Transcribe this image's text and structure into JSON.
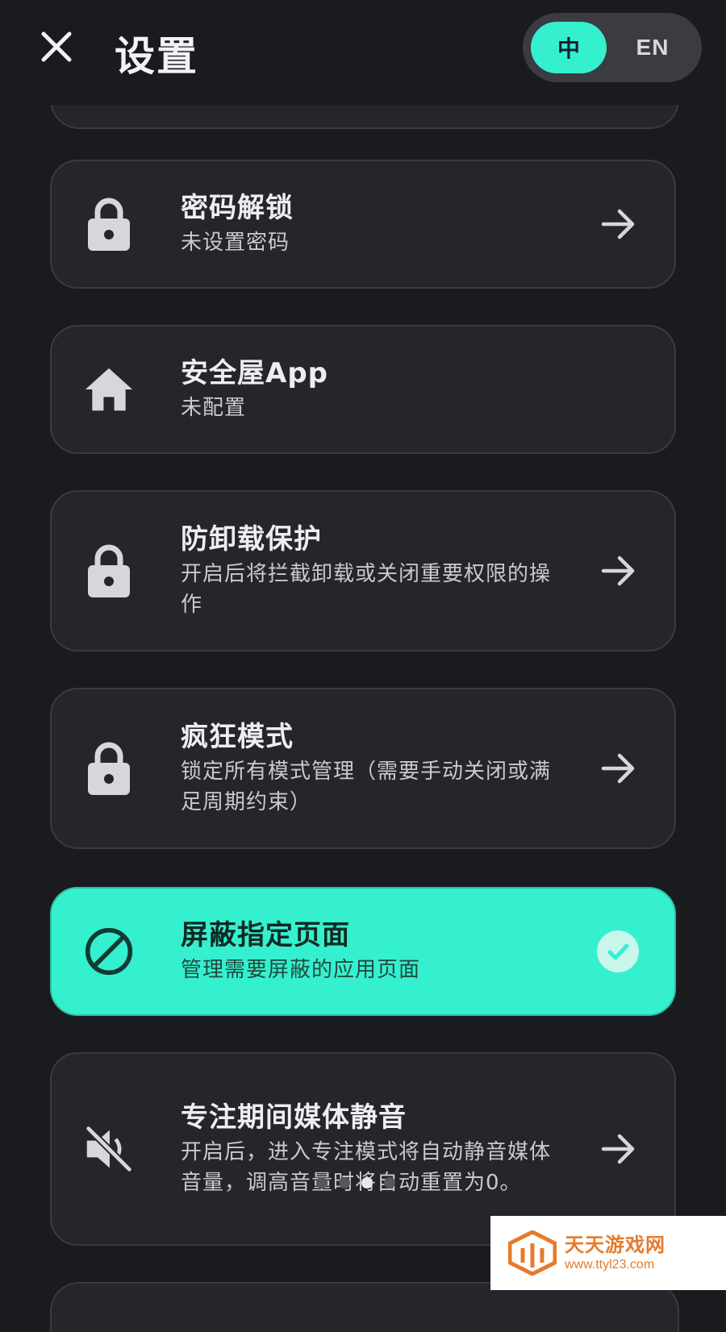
{
  "header": {
    "title": "设置",
    "close_icon": "close-icon",
    "lang": {
      "zh": "中",
      "en": "EN",
      "selected": "zh"
    }
  },
  "colors": {
    "accent": "#35f0cf",
    "background": "#1a1b1f",
    "card": "#25262b"
  },
  "items": [
    {
      "title": "密码解锁",
      "subtitle": "未设置密码",
      "icon": "lock-icon",
      "trailing": "arrow-right-icon"
    },
    {
      "title": "安全屋App",
      "subtitle": "未配置",
      "icon": "home-icon",
      "trailing": "none"
    },
    {
      "title": "防卸载保护",
      "subtitle": "开启后将拦截卸载或关闭重要权限的操作",
      "icon": "lock-icon",
      "trailing": "arrow-right-icon"
    },
    {
      "title": "疯狂模式",
      "subtitle": "锁定所有模式管理（需要手动关闭或满足周期约束）",
      "icon": "lock-icon",
      "trailing": "arrow-right-icon"
    },
    {
      "title": "屏蔽指定页面",
      "subtitle": "管理需要屏蔽的应用页面",
      "icon": "block-icon",
      "trailing": "check-icon",
      "active": true
    },
    {
      "title": "专注期间媒体静音",
      "subtitle": "开启后，进入专注模式将自动静音媒体音量，调高音量时将自动重置为0。",
      "icon": "mute-icon",
      "trailing": "arrow-right-icon"
    }
  ],
  "pager": {
    "count": 4,
    "current": 3
  },
  "watermark": {
    "name": "天天游戏网",
    "url": "www.ttyl23.com"
  }
}
